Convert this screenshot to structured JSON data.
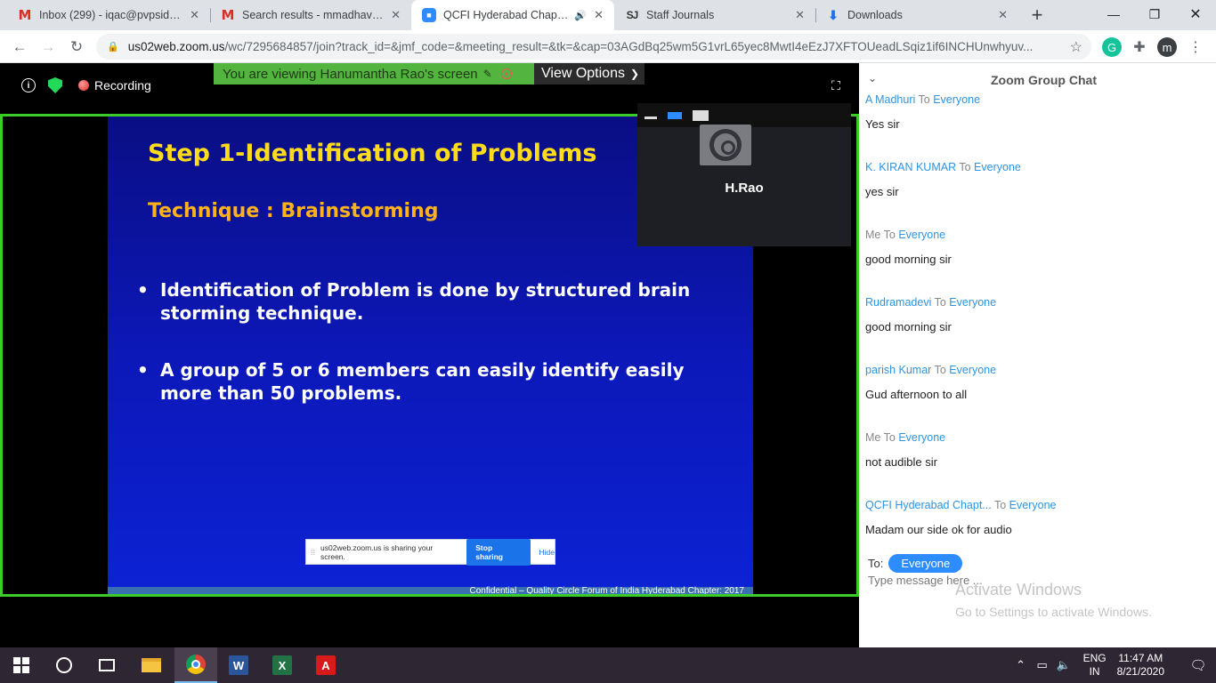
{
  "browser": {
    "tabs": [
      {
        "title": "Inbox (299) - iqac@pvpsiddhar",
        "icon": "gmail-icon"
      },
      {
        "title": "Search results - mmadhavi@pv",
        "icon": "gmail-icon"
      },
      {
        "title": "QCFI Hyderabad Chapter's",
        "icon": "zoom-icon",
        "active": true
      },
      {
        "title": "Staff Journals",
        "icon": "staff-journals-icon"
      },
      {
        "title": "Downloads",
        "icon": "download-icon"
      }
    ],
    "url_domain": "us02web.zoom.us",
    "url_path": "/wc/7295684857/join?track_id=&jmf_code=&meeting_result=&tk=&cap=03AGdBq25wm5G1vrL65yec8MwtI4eEzJ7XFTOUeadLSqiz1if6INCHUnwhyuv...",
    "profile_initial": "m"
  },
  "meeting": {
    "recording_label": "Recording",
    "viewing_banner": "You are viewing Hanumantha Rao's screen",
    "view_options_label": "View Options",
    "participant_name": "H.Rao",
    "share_notice": {
      "text": "us02web.zoom.us is sharing your screen.",
      "stop_label": "Stop sharing",
      "hide_label": "Hide"
    }
  },
  "slide": {
    "title": "Step 1-Identification of Problems",
    "subtitle": "Technique : Brainstorming",
    "bullets": [
      "Identification of Problem is done by structured brain storming technique.",
      "A group of 5 or 6 members can easily identify easily more than 50 problems."
    ],
    "footer": "Confidential – Quality Circle Forum of India Hyderabad Chapter: 2017",
    "colors": {
      "title": "#ffdc1a",
      "subtitle": "#ffb21a",
      "background": "#0c18b8"
    }
  },
  "chat": {
    "title": "Zoom Group Chat",
    "to_word": "To",
    "messages": [
      {
        "sender": "A Madhuri",
        "recipient": "Everyone",
        "text": "Yes sir"
      },
      {
        "sender": "K. KIRAN KUMAR",
        "recipient": "Everyone",
        "text": "yes sir"
      },
      {
        "sender": "Me",
        "recipient": "Everyone",
        "text": "good morning sir"
      },
      {
        "sender": "Rudramadevi",
        "recipient": "Everyone",
        "text": "good morning sir"
      },
      {
        "sender": "parish Kumar",
        "recipient": "Everyone",
        "text": "Gud afternoon to all"
      },
      {
        "sender": "Me",
        "recipient": "Everyone",
        "text": "not audible sir"
      },
      {
        "sender": "QCFI Hyderabad Chapt...",
        "recipient": "Everyone",
        "text": "Madam our side ok for audio"
      }
    ],
    "to_label": "To:",
    "to_value": "Everyone",
    "input_placeholder": "Type message here ...",
    "accent_color": "#2d8cff"
  },
  "watermark": {
    "line1": "Activate Windows",
    "line2": "Go to Settings to activate Windows."
  },
  "taskbar": {
    "lang_line1": "ENG",
    "lang_line2": "IN",
    "time": "11:47 AM",
    "date": "8/21/2020"
  }
}
